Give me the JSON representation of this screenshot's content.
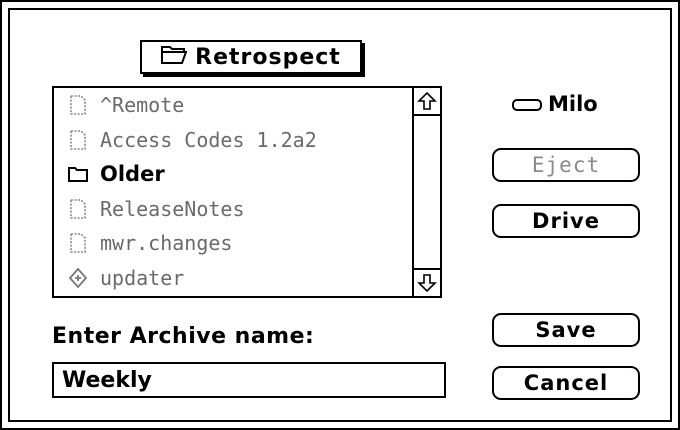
{
  "folder_popup": {
    "label": "Retrospect",
    "icon": "folder-open-icon"
  },
  "file_list": {
    "items": [
      {
        "label": "^Remote",
        "icon": "document-icon",
        "kind": "file",
        "dim": true
      },
      {
        "label": "Access Codes 1.2a2",
        "icon": "document-icon",
        "kind": "file",
        "dim": true
      },
      {
        "label": "Older",
        "icon": "folder-icon",
        "kind": "folder",
        "dim": false
      },
      {
        "label": "ReleaseNotes",
        "icon": "document-icon",
        "kind": "file",
        "dim": true
      },
      {
        "label": "mwr.changes",
        "icon": "document-icon",
        "kind": "file",
        "dim": true
      },
      {
        "label": "updater",
        "icon": "application-icon",
        "kind": "app",
        "dim": true
      }
    ]
  },
  "disk": {
    "label": "Milo",
    "icon": "disk-icon"
  },
  "buttons": {
    "eject": "Eject",
    "drive": "Drive",
    "save": "Save",
    "cancel": "Cancel"
  },
  "prompt": "Enter Archive name:",
  "name_field": {
    "value": "Weekly"
  }
}
